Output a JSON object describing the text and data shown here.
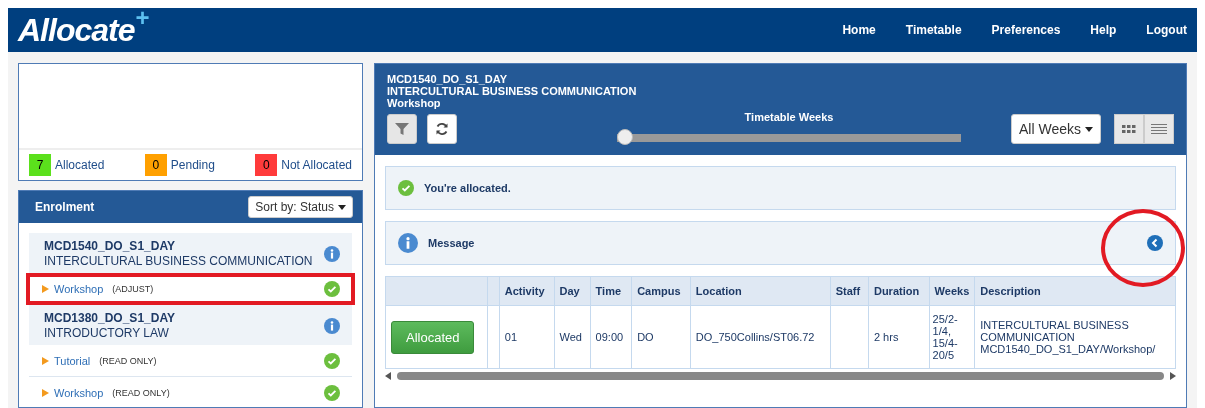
{
  "header": {
    "logo": "Allocate",
    "logo_mark": "+",
    "nav": [
      "Home",
      "Timetable",
      "Preferences",
      "Help",
      "Logout"
    ]
  },
  "summary": [
    {
      "count": "7",
      "label": "Allocated",
      "color": "#5be01c"
    },
    {
      "count": "0",
      "label": "Pending",
      "color": "#ffa000"
    },
    {
      "count": "0",
      "label": "Not Allocated",
      "color": "#ff3b3b"
    }
  ],
  "enrolment": {
    "title": "Enrolment",
    "sort": "Sort by: Status",
    "subjects": [
      {
        "code": "MCD1540_DO_S1_DAY",
        "name": "INTERCULTURAL BUSINESS COMMUNICATION",
        "activities": [
          {
            "name": "Workshop",
            "mode": "(ADJUST)",
            "highlighted": true
          }
        ]
      },
      {
        "code": "MCD1380_DO_S1_DAY",
        "name": "INTRODUCTORY LAW",
        "activities": [
          {
            "name": "Tutorial",
            "mode": "(READ ONLY)",
            "highlighted": false
          },
          {
            "name": "Workshop",
            "mode": "(READ ONLY)",
            "highlighted": false
          }
        ]
      }
    ]
  },
  "detail": {
    "title_lines": [
      "MCD1540_DO_S1_DAY",
      "INTERCULTURAL BUSINESS COMMUNICATION",
      "Workshop"
    ],
    "weeks_label": "Timetable Weeks",
    "weeks_slider": {
      "level": 0
    },
    "weeks_select": "All Weeks",
    "status_message": "You're allocated.",
    "message": {
      "label": "Message",
      "circled": true
    },
    "table": {
      "columns": [
        "",
        "",
        "Activity",
        "Day",
        "Time",
        "Campus",
        "Location",
        "Staff",
        "Duration",
        "Weeks",
        "Description"
      ],
      "rows": [
        {
          "cells": [
            "Allocated",
            "",
            "01",
            "Wed",
            "09:00",
            "DO",
            "DO_750Collins/ST06.72",
            "",
            "2 hrs",
            "25/2-1/4, 15/4-20/5",
            "INTERCULTURAL BUSINESS COMMUNICATION MCD1540_DO_S1_DAY/Workshop/"
          ]
        }
      ]
    }
  }
}
